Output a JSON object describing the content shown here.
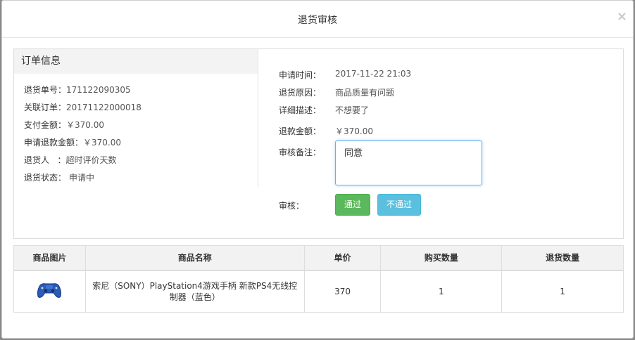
{
  "modal": {
    "title": "退货审核",
    "close_glyph": "×"
  },
  "order": {
    "heading": "订单信息",
    "rows": [
      {
        "label": "退货单号：",
        "value": "171122090305"
      },
      {
        "label": "关联订单：",
        "value": "20171122000018"
      },
      {
        "label": "支付金额：",
        "value": "￥370.00"
      },
      {
        "label": "申请退款金额：",
        "value": "￥370.00"
      },
      {
        "label": "退货人   ：",
        "value": "超时评价天数"
      },
      {
        "label": "退货状态：",
        "value": "申请中"
      }
    ]
  },
  "review": {
    "apply_time_label": "申请时间：",
    "apply_time": "2017-11-22 21:03",
    "reason_label": "退货原因：",
    "reason": "商品质量有问题",
    "detail_label": "详细描述：",
    "detail": "不想要了",
    "refund_label": "退款金额：",
    "refund": "￥370.00",
    "note_label": "审核备注：",
    "note": "同意",
    "audit_label": "审核：",
    "pass_button": "通过",
    "reject_button": "不通过"
  },
  "goods": {
    "headers": [
      "商品图片",
      "商品名称",
      "单价",
      "购买数量",
      "退货数量"
    ],
    "rows": [
      {
        "image_icon": "gamepad-icon",
        "name": "索尼（SONY）PlayStation4游戏手柄 新款PS4无线控制器（蓝色）",
        "price": "370",
        "qty": "1",
        "return_qty": "1"
      }
    ]
  },
  "colors": {
    "pass": "#5cb85c",
    "reject": "#5bc0de",
    "link": "#337ab7",
    "focus_border": "#66afe9"
  }
}
